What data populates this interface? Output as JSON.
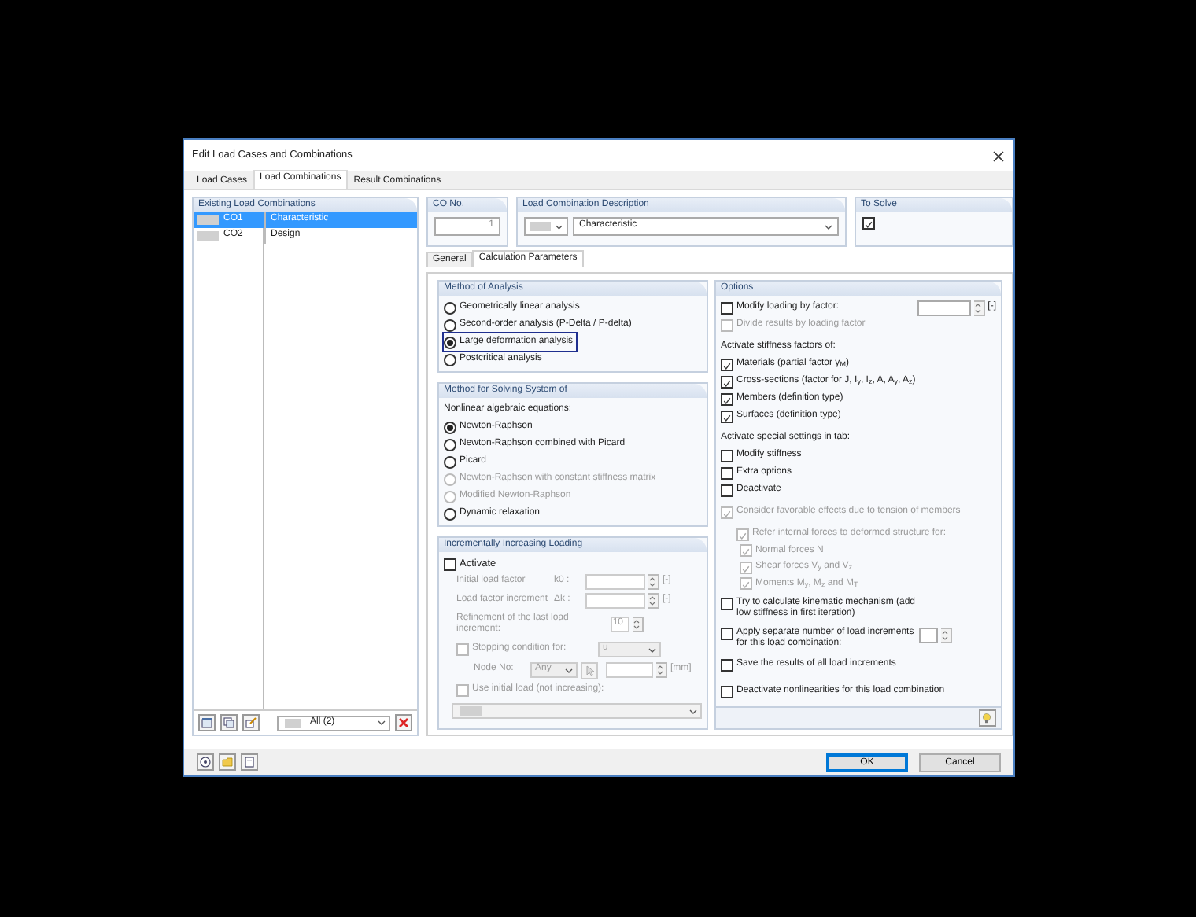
{
  "window": {
    "title": "Edit Load Cases and Combinations"
  },
  "tabs": [
    {
      "label": "Load Cases",
      "selected": false
    },
    {
      "label": "Load Combinations",
      "selected": true
    },
    {
      "label": "Result Combinations",
      "selected": false
    }
  ],
  "existing": {
    "title": "Existing Load Combinations",
    "filter": "All (2)",
    "rows": [
      {
        "no": "CO1",
        "description": "Characteristic",
        "selected": true
      },
      {
        "no": "CO2",
        "description": "Design",
        "selected": false
      }
    ]
  },
  "co_no": {
    "label": "CO No.",
    "value": "1"
  },
  "description": {
    "label": "Load Combination Description",
    "value": "Characteristic"
  },
  "to_solve": {
    "label": "To Solve",
    "checked": true
  },
  "inner_tabs": [
    {
      "label": "General",
      "selected": false
    },
    {
      "label": "Calculation Parameters",
      "selected": true
    }
  ],
  "method_of_analysis": {
    "title": "Method of Analysis",
    "options": [
      {
        "label": "Geometrically linear analysis",
        "selected": false,
        "focused": false
      },
      {
        "label": "Second-order analysis (P-Delta / P-delta)",
        "selected": false,
        "focused": false
      },
      {
        "label": "Large deformation analysis",
        "selected": true,
        "focused": true
      },
      {
        "label": "Postcritical analysis",
        "selected": false,
        "focused": false
      }
    ]
  },
  "solving": {
    "title": "Method for Solving System of",
    "subtitle": "Nonlinear algebraic equations:",
    "options": [
      {
        "label": "Newton-Raphson",
        "selected": true,
        "disabled": false
      },
      {
        "label": "Newton-Raphson combined with Picard",
        "selected": false,
        "disabled": false
      },
      {
        "label": "Picard",
        "selected": false,
        "disabled": false
      },
      {
        "label": "Newton-Raphson with constant stiffness matrix",
        "selected": false,
        "disabled": true
      },
      {
        "label": "Modified Newton-Raphson",
        "selected": false,
        "disabled": true
      },
      {
        "label": "Dynamic relaxation",
        "selected": false,
        "disabled": false
      }
    ]
  },
  "incremental": {
    "title": "Incrementally Increasing Loading",
    "activate": {
      "label": "Activate",
      "checked": false
    },
    "fields": [
      {
        "label": "Initial load factor",
        "symbol": "k0 :",
        "unit": "[-]"
      },
      {
        "label": "Load factor increment",
        "symbol": "Δk :",
        "unit": "[-]"
      }
    ],
    "refinement": {
      "label": "Refinement of the last load increment:",
      "value": "10"
    },
    "stopping": {
      "label": "Stopping condition for:",
      "checked": false,
      "value": "u"
    },
    "node": {
      "label": "Node No:",
      "value": "Any",
      "unit": "[mm]"
    },
    "initial_load": {
      "label": "Use initial load (not increasing):",
      "checked": false
    }
  },
  "options": {
    "title": "Options",
    "items": [
      {
        "kind": "checkbox",
        "label": "Modify loading by factor:",
        "checked": false,
        "disabled": false,
        "unit": "[-]"
      },
      {
        "kind": "checkbox",
        "label": "Divide results by loading factor",
        "checked": false,
        "disabled": true
      },
      {
        "kind": "heading",
        "label": "Activate stiffness factors of:"
      },
      {
        "kind": "checkbox",
        "label": "Materials (partial factor γ$_{M}$)",
        "checked": true,
        "disabled": false
      },
      {
        "kind": "checkbox",
        "label": "Cross-sections (factor for J, I$_{y}$, I$_{z}$, A, A$_{y}$, A$_{z}$)",
        "checked": true,
        "disabled": false
      },
      {
        "kind": "checkbox",
        "label": "Members (definition type)",
        "checked": true,
        "disabled": false
      },
      {
        "kind": "checkbox",
        "label": "Surfaces (definition type)",
        "checked": true,
        "disabled": false
      },
      {
        "kind": "heading",
        "label": "Activate special settings in tab:"
      },
      {
        "kind": "checkbox",
        "label": "Modify stiffness",
        "checked": false,
        "disabled": false
      },
      {
        "kind": "checkbox",
        "label": "Extra options",
        "checked": false,
        "disabled": false
      },
      {
        "kind": "checkbox",
        "label": "Deactivate",
        "checked": false,
        "disabled": false
      },
      {
        "kind": "checkbox",
        "label": "Consider favorable effects due to tension of members",
        "checked": true,
        "disabled": true
      },
      {
        "kind": "checkbox",
        "label": "Refer internal forces to deformed structure for:",
        "checked": true,
        "disabled": true,
        "children": [
          {
            "label": "Normal forces N",
            "checked": true
          },
          {
            "label": "Shear forces V$_{y}$ and V$_{z}$",
            "checked": true
          },
          {
            "label": "Moments M$_{y}$, M$_{z}$ and M$_{T}$",
            "checked": true
          }
        ]
      },
      {
        "kind": "checkbox",
        "label": "Try to calculate kinematic mechanism (add low stiffness in first iteration)",
        "checked": false,
        "disabled": false
      },
      {
        "kind": "spin",
        "label": "Apply separate number of load increments for this load combination:",
        "checked": false,
        "disabled": false
      },
      {
        "kind": "checkbox",
        "label": "Save the results of all load increments",
        "checked": false,
        "disabled": false
      },
      {
        "kind": "checkbox",
        "label": "Deactivate nonlinearities for this load combination",
        "checked": false,
        "disabled": false
      }
    ]
  },
  "buttons": [
    {
      "label": "OK",
      "default": true
    },
    {
      "label": "Cancel",
      "default": false
    }
  ]
}
